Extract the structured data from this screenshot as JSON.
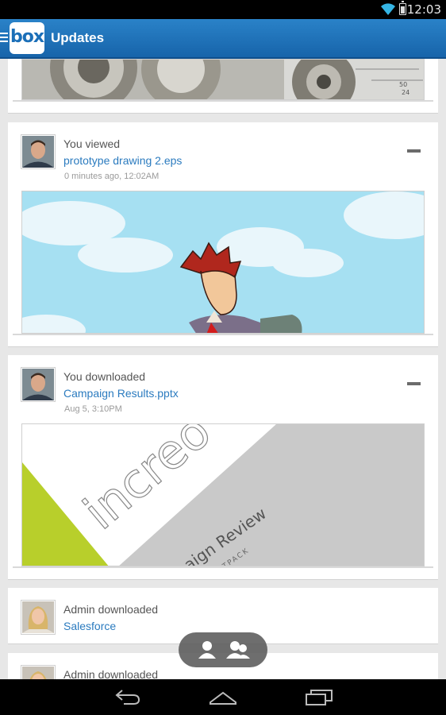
{
  "status_bar": {
    "time": "12:03",
    "icons": [
      "wifi-icon",
      "battery-icon"
    ]
  },
  "action_bar": {
    "logo_text": "box",
    "title": "Updates"
  },
  "colors": {
    "action_bar": "#1f6fb8",
    "link": "#2b7bbf",
    "background": "#e7e7e7"
  },
  "feed": [
    {
      "action": "You viewed",
      "file": "prototype drawing 2.eps",
      "time": "0 minutes ago, 12:02AM"
    },
    {
      "action": "You downloaded",
      "file": "Campaign Results.pptx",
      "time": "Aug 5, 3:10PM"
    },
    {
      "action": "Admin downloaded",
      "file": "Salesforce"
    },
    {
      "action": "Admin downloaded"
    }
  ],
  "previews": {
    "campaign": {
      "brand": "increo",
      "subtitle": "aign Review",
      "sub2": "TPACK"
    }
  },
  "toggle": {
    "icons": [
      "single-user-icon",
      "group-users-icon"
    ]
  },
  "navbar": {
    "icons": [
      "back-icon",
      "home-icon",
      "recent-apps-icon"
    ]
  }
}
